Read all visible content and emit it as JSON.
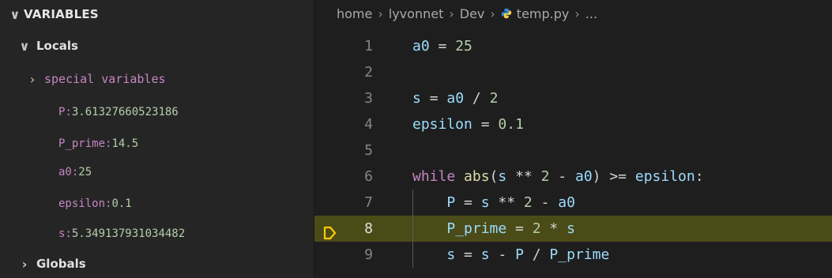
{
  "variables": {
    "header": "VARIABLES",
    "locals_label": "Locals",
    "special_label": "special variables",
    "items": [
      {
        "name": "P",
        "value": "3.61327660523186"
      },
      {
        "name": "P_prime",
        "value": "14.5"
      },
      {
        "name": "a0",
        "value": "25"
      },
      {
        "name": "epsilon",
        "value": "0.1"
      },
      {
        "name": "s",
        "value": "5.349137931034482"
      }
    ],
    "globals_label": "Globals"
  },
  "breadcrumb": {
    "parts": [
      "home",
      "lyvonnet",
      "Dev",
      "temp.py",
      "..."
    ]
  },
  "editor": {
    "current_line": 8,
    "line_numbers": [
      "1",
      "2",
      "3",
      "4",
      "5",
      "6",
      "7",
      "8",
      "9"
    ]
  },
  "colors": {
    "highlight_line": "#4b4b18",
    "debug_arrow": "#ffcc00",
    "variable_name": "#c586c0",
    "variable_value": "#b5cea8"
  },
  "icons": [
    "chevron-down-icon",
    "chevron-right-icon",
    "python-file-icon",
    "debug-current-line-icon"
  ]
}
